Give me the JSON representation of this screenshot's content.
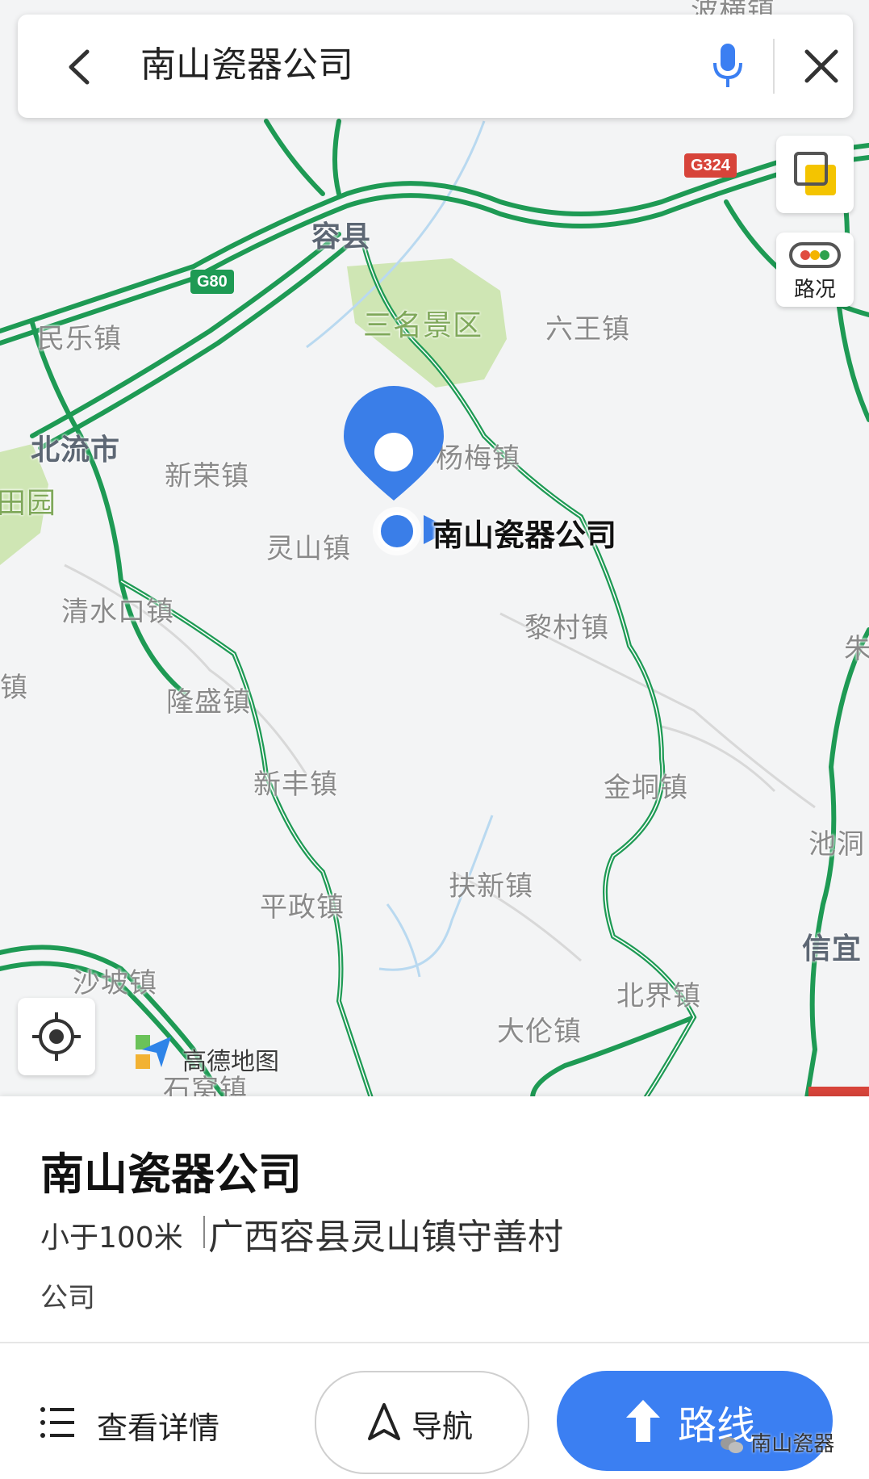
{
  "search": {
    "query": "南山瓷器公司"
  },
  "map_controls": {
    "traffic_label": "路况"
  },
  "map": {
    "roads": [
      "G324",
      "G80"
    ],
    "places": {
      "rongxian": "容县",
      "sanming": "三名景区",
      "liuwang": "六王镇",
      "minle": "民乐镇",
      "beiliu": "北流市",
      "tianyuan": "田园",
      "xinrong": "新荣镇",
      "yangmei": "杨梅镇",
      "lingshan": "灵山镇",
      "qingshuikou": "清水口镇",
      "licun": "黎村镇",
      "zhen_left": "镇",
      "longsheng": "隆盛镇",
      "xinfeng": "新丰镇",
      "jindong": "金垌镇",
      "chidong": "池洞",
      "zhu": "朱",
      "fuxin": "扶新镇",
      "pingzheng": "平政镇",
      "xinyi": "信宜",
      "shapo": "沙坡镇",
      "beijie": "北界镇",
      "dalun": "大伦镇",
      "shiwo": "石窝镇",
      "pohui_top": "波横镇"
    },
    "pin_label": "南山瓷器公司",
    "logo_text": "高德地图"
  },
  "place": {
    "name": "南山瓷器公司",
    "distance": "小于100米",
    "address": "广西容县灵山镇守善村",
    "category": "公司"
  },
  "actions": {
    "details": "查看详情",
    "navigate": "导航",
    "route": "路线"
  },
  "watermark": "南山瓷器",
  "colors": {
    "road_green": "#1e9a54",
    "accent_blue": "#3b7ff2",
    "pin_blue": "#3a7ee8",
    "park_green": "#cfe6b4"
  }
}
